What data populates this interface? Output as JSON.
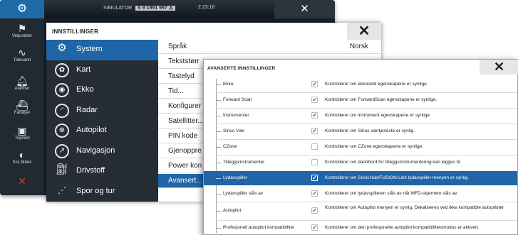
{
  "top_bar": {
    "sim_label": "SIMULATOR",
    "sim_mode": "S 9 1991 997 ⚠",
    "time": "2:23:16",
    "close_icon": "close-icon"
  },
  "sidebar": {
    "items": [
      {
        "label": "Veipunkter",
        "icon": "flag-icon"
      },
      {
        "label": "Tidevann",
        "icon": "wave-icon"
      },
      {
        "label": "Alarmer",
        "icon": "bell-icon"
      },
      {
        "label": "Fartøyer",
        "icon": "boat-icon"
      },
      {
        "label": "Tripintel",
        "icon": "trip-icon"
      },
      {
        "label": "Sol, Måne",
        "icon": "sun-moon-icon"
      }
    ]
  },
  "settings": {
    "title": "INNSTILLINGER",
    "categories": [
      {
        "label": "System",
        "icon": "gear-icon"
      },
      {
        "label": "Kart",
        "icon": "chart-icon"
      },
      {
        "label": "Ekko",
        "icon": "sonar-icon"
      },
      {
        "label": "Radar",
        "icon": "radar-icon"
      },
      {
        "label": "Autopilot",
        "icon": "helm-icon"
      },
      {
        "label": "Navigasjon",
        "icon": "compass-icon"
      },
      {
        "label": "Drivstoff",
        "icon": "fuel-icon"
      },
      {
        "label": "Spor og tur",
        "icon": "track-icon"
      }
    ],
    "options": [
      {
        "label": "Språk",
        "value": "Norsk"
      },
      {
        "label": "Tekststørr",
        "value": ""
      },
      {
        "label": "Tastelyd",
        "value": ""
      },
      {
        "label": "Tid...",
        "value": ""
      },
      {
        "label": "Konfigurer",
        "value": ""
      },
      {
        "label": "Satellitter...",
        "value": ""
      },
      {
        "label": "PIN kode",
        "value": ""
      },
      {
        "label": "Gjenoppre",
        "value": ""
      },
      {
        "label": "Power kon",
        "value": ""
      },
      {
        "label": "Avansert...",
        "value": ""
      }
    ]
  },
  "advanced": {
    "title": "AVANSERTE INNSTILLINGER",
    "rows": [
      {
        "label": "Ekko",
        "checked": "✓",
        "desc": "Kontrollerer om ekkolodd egenskapene er synlige."
      },
      {
        "label": "Forward Scan",
        "checked": "✓",
        "desc": "Kontrollerer om ForwardScan egenskapene er synlige."
      },
      {
        "label": "Instrumenter",
        "checked": "✓",
        "desc": "Kontrollerer om  instrument egenskapene er synlige."
      },
      {
        "label": "Sirius Vær",
        "checked": "✓",
        "desc": "Kontrollerer om Sirius værtjeneste er synlig."
      },
      {
        "label": "CZone",
        "checked": "",
        "desc": "Kontrollerer om CZone egenskapene er synlige."
      },
      {
        "label": "Tilleggsinstrumenter",
        "checked": "",
        "desc": "Kontrollerer om dashbord for tilleggsinstrumentering kan legges til."
      },
      {
        "label": "Lydavspiller",
        "checked": "✓",
        "desc": "Kontrollerer om SonicHub/FUSION-Link lydavspiller-menyen er synlig."
      },
      {
        "label": "Lydavspiller slås av",
        "checked": "✓",
        "desc": "Kontrollerer om lydavspilleren slås av når MFD-skjermen slås av."
      },
      {
        "label": "Autopilot",
        "checked": "✓",
        "desc": "Kontrollerer om Autopilot menyen er synlig. Dekativeres ved ikke kompatible autopiloter"
      },
      {
        "label": "Profesjonell autopilot kompatibilitet",
        "checked": "✓",
        "desc": "Kontrollerer om den profesjonelle autopilot kompatibilitetsmodus er aktivert."
      }
    ]
  }
}
